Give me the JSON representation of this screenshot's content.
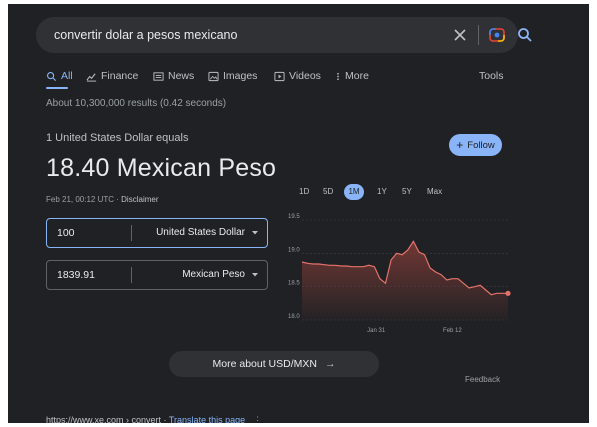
{
  "search": {
    "query": "convertir dolar a pesos mexicano"
  },
  "tabs": [
    {
      "label": "All",
      "icon": "search-icon",
      "active": true
    },
    {
      "label": "Finance",
      "icon": "finance-icon"
    },
    {
      "label": "News",
      "icon": "news-icon"
    },
    {
      "label": "Images",
      "icon": "image-icon"
    },
    {
      "label": "Videos",
      "icon": "video-icon"
    },
    {
      "label": "More",
      "icon": "more-vert-icon"
    }
  ],
  "tools_label": "Tools",
  "results_stats": "About 10,300,000 results (0.42 seconds)",
  "converter": {
    "equals_label": "1 United States Dollar equals",
    "rate_text": "18.40 Mexican Peso",
    "timestamp": "Feb 21, 00:12 UTC",
    "separator": " · ",
    "disclaimer": "Disclaimer",
    "follow_label": "Follow",
    "from": {
      "amount": "100",
      "currency": "United States Dollar"
    },
    "to": {
      "amount": "1839.91",
      "currency": "Mexican Peso"
    }
  },
  "chart_data": {
    "type": "area",
    "ranges": [
      "1D",
      "5D",
      "1M",
      "1Y",
      "5Y",
      "Max"
    ],
    "active_range": "1M",
    "y_ticks": [
      18.0,
      18.5,
      19.0,
      19.5
    ],
    "ylim": [
      18.0,
      19.5
    ],
    "x_ticks": [
      "Jan 31",
      "Feb 12"
    ],
    "line_color": "#e5726a",
    "fill_color": "#7a3a36",
    "values": [
      18.87,
      18.85,
      18.84,
      18.84,
      18.83,
      18.82,
      18.82,
      18.81,
      18.81,
      18.8,
      18.8,
      18.8,
      18.82,
      18.8,
      18.62,
      18.55,
      18.9,
      19.0,
      18.98,
      19.05,
      19.18,
      19.02,
      18.98,
      18.78,
      18.72,
      18.68,
      18.6,
      18.62,
      18.62,
      18.55,
      18.48,
      18.5,
      18.52,
      18.45,
      18.38,
      18.4,
      18.4,
      18.4
    ],
    "x_tick_positions": [
      0.36,
      0.73
    ]
  },
  "more_button_label": "More about USD/MXN",
  "feedback_label": "Feedback",
  "result": {
    "url": "https://www.xe.com › convert",
    "separator": " · ",
    "translate_label": "Translate this page",
    "menu_glyph": "⋮"
  },
  "colors": {
    "background": "#202124",
    "accent": "#8ab4f8"
  }
}
